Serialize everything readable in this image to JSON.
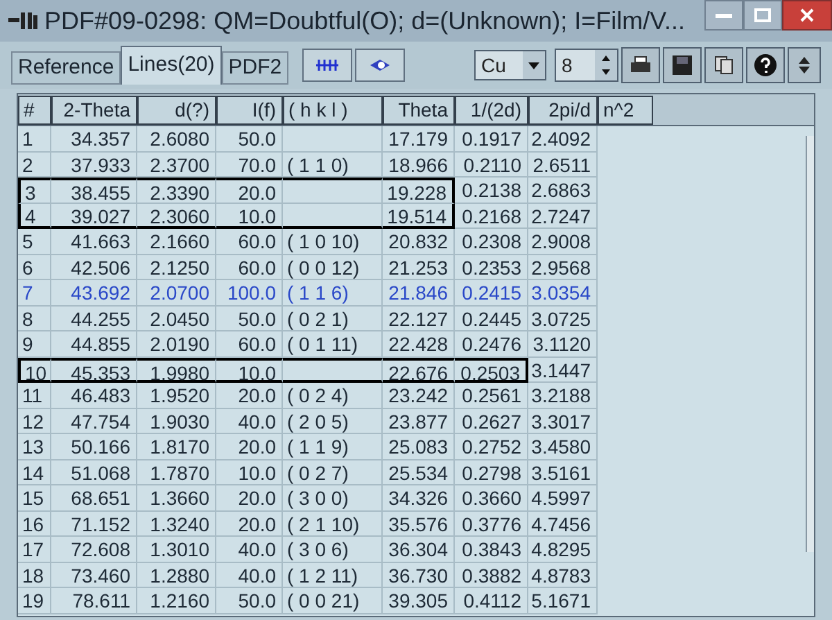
{
  "window": {
    "title": "PDF#09-0298: QM=Doubtful(O); d=(Unknown); I=Film/V..."
  },
  "tabs": [
    {
      "label": "Reference",
      "selected": false
    },
    {
      "label": "Lines(20)",
      "selected": true
    },
    {
      "label": "PDF2",
      "selected": false
    }
  ],
  "toolbar": {
    "radiation": "Cu",
    "count": "8"
  },
  "table": {
    "columns": [
      "#",
      "2-Theta",
      "d(?)",
      "I(f)",
      "( h k l )",
      "Theta",
      "1/(2d)",
      "2pi/d",
      "n^2"
    ],
    "rows": [
      {
        "cells": [
          "1",
          "34.357",
          "2.6080",
          "50.0",
          "",
          "17.179",
          "0.1917",
          "2.4092"
        ],
        "selected": false
      },
      {
        "cells": [
          "2",
          "37.933",
          "2.3700",
          "70.0",
          "( 1 1 0)",
          "18.966",
          "0.2110",
          "2.6511"
        ],
        "selected": false
      },
      {
        "cells": [
          "3",
          "38.455",
          "2.3390",
          "20.0",
          "",
          "19.228",
          "0.2138",
          "2.6863"
        ],
        "selected": false,
        "kind": "boxed"
      },
      {
        "cells": [
          "4",
          "39.027",
          "2.3060",
          "10.0",
          "",
          "19.514",
          "0.2168",
          "2.7247"
        ],
        "selected": false,
        "kind": "boxed"
      },
      {
        "cells": [
          "5",
          "41.663",
          "2.1660",
          "60.0",
          "( 1 0 10)",
          "20.832",
          "0.2308",
          "2.9008"
        ],
        "selected": false
      },
      {
        "cells": [
          "6",
          "42.506",
          "2.1250",
          "60.0",
          "( 0 0 12)",
          "21.253",
          "0.2353",
          "2.9568"
        ],
        "selected": false
      },
      {
        "cells": [
          "7",
          "43.692",
          "2.0700",
          "100.0",
          "( 1 1 6)",
          "21.846",
          "0.2415",
          "3.0354"
        ],
        "selected": true
      },
      {
        "cells": [
          "8",
          "44.255",
          "2.0450",
          "50.0",
          "( 0 2 1)",
          "22.127",
          "0.2445",
          "3.0725"
        ],
        "selected": false
      },
      {
        "cells": [
          "9",
          "44.855",
          "2.0190",
          "60.0",
          "( 0 1 11)",
          "22.428",
          "0.2476",
          "3.1120"
        ],
        "selected": false
      },
      {
        "cells": [
          "10",
          "45.353",
          "1.9980",
          "10.0",
          "",
          "22.676",
          "0.2503",
          "3.1447"
        ],
        "selected": false,
        "kind": "boxedwide"
      },
      {
        "cells": [
          "11",
          "46.483",
          "1.9520",
          "20.0",
          "( 0 2 4)",
          "23.242",
          "0.2561",
          "3.2188"
        ],
        "selected": false
      },
      {
        "cells": [
          "12",
          "47.754",
          "1.9030",
          "40.0",
          "( 2 0 5)",
          "23.877",
          "0.2627",
          "3.3017"
        ],
        "selected": false
      },
      {
        "cells": [
          "13",
          "50.166",
          "1.8170",
          "20.0",
          "( 1 1 9)",
          "25.083",
          "0.2752",
          "3.4580"
        ],
        "selected": false
      },
      {
        "cells": [
          "14",
          "51.068",
          "1.7870",
          "10.0",
          "( 0 2 7)",
          "25.534",
          "0.2798",
          "3.5161"
        ],
        "selected": false
      },
      {
        "cells": [
          "15",
          "68.651",
          "1.3660",
          "20.0",
          "( 3 0 0)",
          "34.326",
          "0.3660",
          "4.5997"
        ],
        "selected": false
      },
      {
        "cells": [
          "16",
          "71.152",
          "1.3240",
          "20.0",
          "( 2 1 10)",
          "35.576",
          "0.3776",
          "4.7456"
        ],
        "selected": false
      },
      {
        "cells": [
          "17",
          "72.608",
          "1.3010",
          "40.0",
          "( 3 0 6)",
          "36.304",
          "0.3843",
          "4.8295"
        ],
        "selected": false
      },
      {
        "cells": [
          "18",
          "73.460",
          "1.2880",
          "40.0",
          "( 1 2 11)",
          "36.730",
          "0.3882",
          "4.8783"
        ],
        "selected": false
      },
      {
        "cells": [
          "19",
          "78.611",
          "1.2160",
          "50.0",
          "( 0 0 21)",
          "39.305",
          "0.4112",
          "5.1671"
        ],
        "selected": false
      }
    ]
  }
}
